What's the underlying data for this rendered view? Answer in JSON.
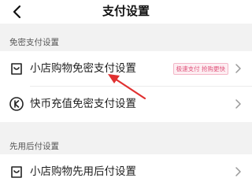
{
  "header": {
    "title": "支付设置",
    "back_icon": "chevron-left-icon"
  },
  "sections": [
    {
      "title": "免密支付设置",
      "items": [
        {
          "label": "小店购物免密支付设置",
          "icon": "shopping-bag-icon",
          "badge": "极速支付 抢购更快"
        },
        {
          "label": "快币充值免密支付设置",
          "icon": "kuaibi-coin-icon"
        }
      ]
    },
    {
      "title": "先用后付设置",
      "items": [
        {
          "label": "小店购物先用后付设置",
          "icon": "shopping-bag-icon"
        }
      ]
    }
  ],
  "colors": {
    "badge_text": "#e0527a",
    "badge_bg": "#fdeef2",
    "annotation_arrow": "#e03030"
  }
}
